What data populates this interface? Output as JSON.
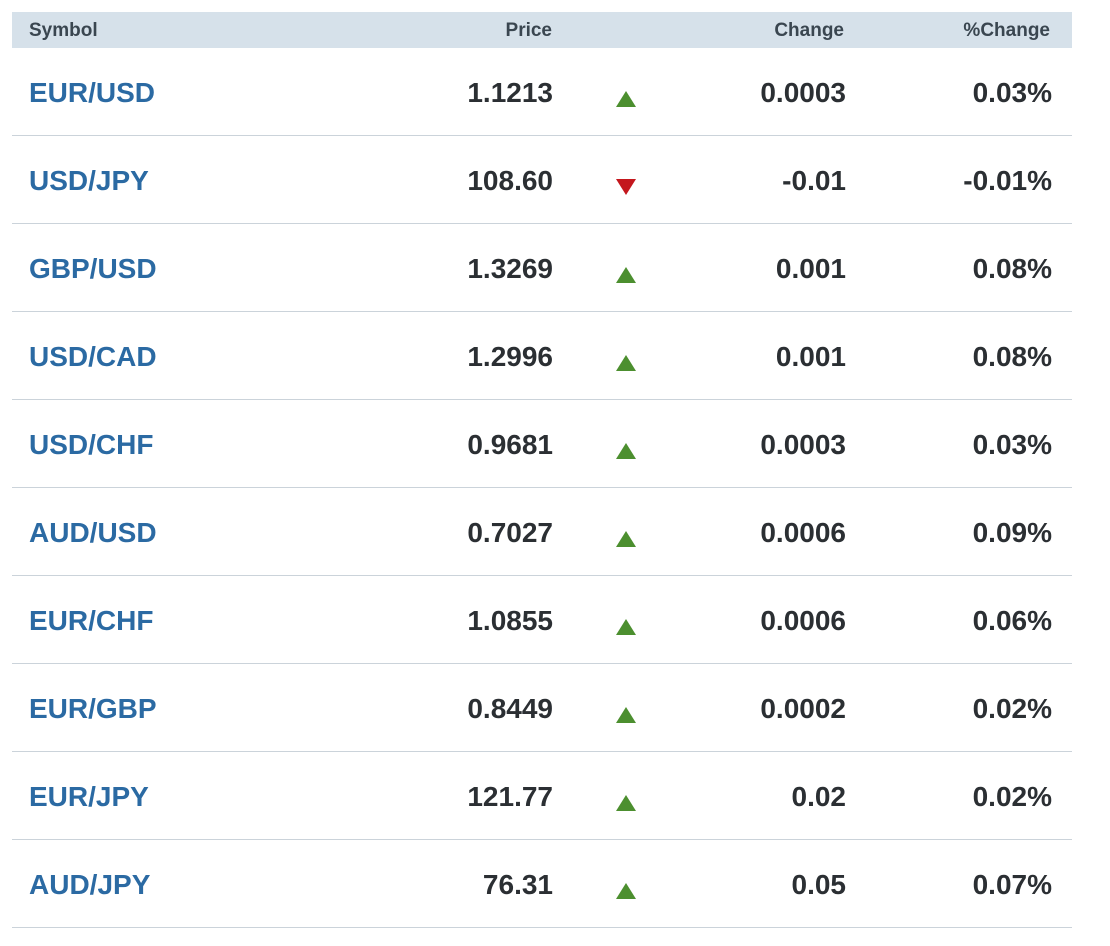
{
  "table": {
    "headers": {
      "symbol": "Symbol",
      "price": "Price",
      "change": "Change",
      "pct_change": "%Change"
    },
    "colors": {
      "header_bg": "#d6e1ea",
      "symbol_link": "#2b6aa3",
      "up": "#4c8f2f",
      "down": "#c4171d"
    },
    "rows": [
      {
        "symbol": "EUR/USD",
        "price": "1.1213",
        "direction": "up",
        "change": "0.0003",
        "pct_change": "0.03%"
      },
      {
        "symbol": "USD/JPY",
        "price": "108.60",
        "direction": "down",
        "change": "-0.01",
        "pct_change": "-0.01%"
      },
      {
        "symbol": "GBP/USD",
        "price": "1.3269",
        "direction": "up",
        "change": "0.001",
        "pct_change": "0.08%"
      },
      {
        "symbol": "USD/CAD",
        "price": "1.2996",
        "direction": "up",
        "change": "0.001",
        "pct_change": "0.08%"
      },
      {
        "symbol": "USD/CHF",
        "price": "0.9681",
        "direction": "up",
        "change": "0.0003",
        "pct_change": "0.03%"
      },
      {
        "symbol": "AUD/USD",
        "price": "0.7027",
        "direction": "up",
        "change": "0.0006",
        "pct_change": "0.09%"
      },
      {
        "symbol": "EUR/CHF",
        "price": "1.0855",
        "direction": "up",
        "change": "0.0006",
        "pct_change": "0.06%"
      },
      {
        "symbol": "EUR/GBP",
        "price": "0.8449",
        "direction": "up",
        "change": "0.0002",
        "pct_change": "0.02%"
      },
      {
        "symbol": "EUR/JPY",
        "price": "121.77",
        "direction": "up",
        "change": "0.02",
        "pct_change": "0.02%"
      },
      {
        "symbol": "AUD/JPY",
        "price": "76.31",
        "direction": "up",
        "change": "0.05",
        "pct_change": "0.07%"
      }
    ]
  }
}
